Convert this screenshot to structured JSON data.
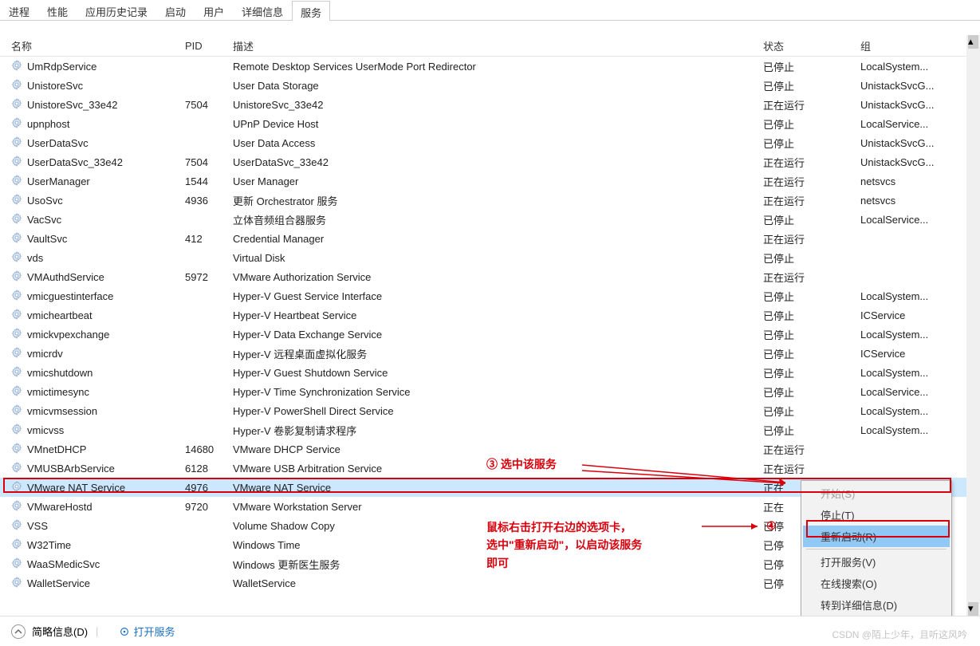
{
  "tabs": [
    "进程",
    "性能",
    "应用历史记录",
    "启动",
    "用户",
    "详细信息",
    "服务"
  ],
  "active_tab": 6,
  "columns": {
    "name": "名称",
    "pid": "PID",
    "desc": "描述",
    "status": "状态",
    "group": "组"
  },
  "rows": [
    {
      "name": "UmRdpService",
      "pid": "",
      "desc": "Remote Desktop Services UserMode Port Redirector",
      "status": "已停止",
      "group": "LocalSystem..."
    },
    {
      "name": "UnistoreSvc",
      "pid": "",
      "desc": "User Data Storage",
      "status": "已停止",
      "group": "UnistackSvcG..."
    },
    {
      "name": "UnistoreSvc_33e42",
      "pid": "7504",
      "desc": "UnistoreSvc_33e42",
      "status": "正在运行",
      "group": "UnistackSvcG..."
    },
    {
      "name": "upnphost",
      "pid": "",
      "desc": "UPnP Device Host",
      "status": "已停止",
      "group": "LocalService..."
    },
    {
      "name": "UserDataSvc",
      "pid": "",
      "desc": "User Data Access",
      "status": "已停止",
      "group": "UnistackSvcG..."
    },
    {
      "name": "UserDataSvc_33e42",
      "pid": "7504",
      "desc": "UserDataSvc_33e42",
      "status": "正在运行",
      "group": "UnistackSvcG..."
    },
    {
      "name": "UserManager",
      "pid": "1544",
      "desc": "User Manager",
      "status": "正在运行",
      "group": "netsvcs"
    },
    {
      "name": "UsoSvc",
      "pid": "4936",
      "desc": "更新 Orchestrator 服务",
      "status": "正在运行",
      "group": "netsvcs"
    },
    {
      "name": "VacSvc",
      "pid": "",
      "desc": "立体音频组合器服务",
      "status": "已停止",
      "group": "LocalService..."
    },
    {
      "name": "VaultSvc",
      "pid": "412",
      "desc": "Credential Manager",
      "status": "正在运行",
      "group": ""
    },
    {
      "name": "vds",
      "pid": "",
      "desc": "Virtual Disk",
      "status": "已停止",
      "group": ""
    },
    {
      "name": "VMAuthdService",
      "pid": "5972",
      "desc": "VMware Authorization Service",
      "status": "正在运行",
      "group": ""
    },
    {
      "name": "vmicguestinterface",
      "pid": "",
      "desc": "Hyper-V Guest Service Interface",
      "status": "已停止",
      "group": "LocalSystem..."
    },
    {
      "name": "vmicheartbeat",
      "pid": "",
      "desc": "Hyper-V Heartbeat Service",
      "status": "已停止",
      "group": "ICService"
    },
    {
      "name": "vmickvpexchange",
      "pid": "",
      "desc": "Hyper-V Data Exchange Service",
      "status": "已停止",
      "group": "LocalSystem..."
    },
    {
      "name": "vmicrdv",
      "pid": "",
      "desc": "Hyper-V 远程桌面虚拟化服务",
      "status": "已停止",
      "group": "ICService"
    },
    {
      "name": "vmicshutdown",
      "pid": "",
      "desc": "Hyper-V Guest Shutdown Service",
      "status": "已停止",
      "group": "LocalSystem..."
    },
    {
      "name": "vmictimesync",
      "pid": "",
      "desc": "Hyper-V Time Synchronization Service",
      "status": "已停止",
      "group": "LocalService..."
    },
    {
      "name": "vmicvmsession",
      "pid": "",
      "desc": "Hyper-V PowerShell Direct Service",
      "status": "已停止",
      "group": "LocalSystem..."
    },
    {
      "name": "vmicvss",
      "pid": "",
      "desc": "Hyper-V 卷影复制请求程序",
      "status": "已停止",
      "group": "LocalSystem..."
    },
    {
      "name": "VMnetDHCP",
      "pid": "14680",
      "desc": "VMware DHCP Service",
      "status": "正在运行",
      "group": ""
    },
    {
      "name": "VMUSBArbService",
      "pid": "6128",
      "desc": "VMware USB Arbitration Service",
      "status": "正在运行",
      "group": ""
    },
    {
      "name": "VMware NAT Service",
      "pid": "4976",
      "desc": "VMware NAT Service",
      "status": "正在",
      "group": "",
      "selected": true
    },
    {
      "name": "VMwareHostd",
      "pid": "9720",
      "desc": "VMware Workstation Server",
      "status": "正在",
      "group": ""
    },
    {
      "name": "VSS",
      "pid": "",
      "desc": "Volume Shadow Copy",
      "status": "已停",
      "group": ""
    },
    {
      "name": "W32Time",
      "pid": "",
      "desc": "Windows Time",
      "status": "已停",
      "group": ""
    },
    {
      "name": "WaaSMedicSvc",
      "pid": "",
      "desc": "Windows 更新医生服务",
      "status": "已停",
      "group": ""
    },
    {
      "name": "WalletService",
      "pid": "",
      "desc": "WalletService",
      "status": "已停",
      "group": ""
    }
  ],
  "context_menu": {
    "items": [
      {
        "label": "开始(S)",
        "disabled": true
      },
      {
        "label": "停止(T)"
      },
      {
        "label": "重新启动(R)",
        "selected": true
      },
      {
        "sep": true
      },
      {
        "label": "打开服务(V)"
      },
      {
        "label": "在线搜索(O)"
      },
      {
        "label": "转到详细信息(D)"
      }
    ]
  },
  "footer": {
    "brief": "简略信息(D)",
    "open_services": "打开服务"
  },
  "annotations": {
    "a3": "③ 选中该服务",
    "a4": "④",
    "text": "鼠标右击打开右边的选项卡，\n选中\"重新启动\"，以启动该服务\n即可"
  },
  "watermark": "CSDN @陌上少年，且听这风吟"
}
